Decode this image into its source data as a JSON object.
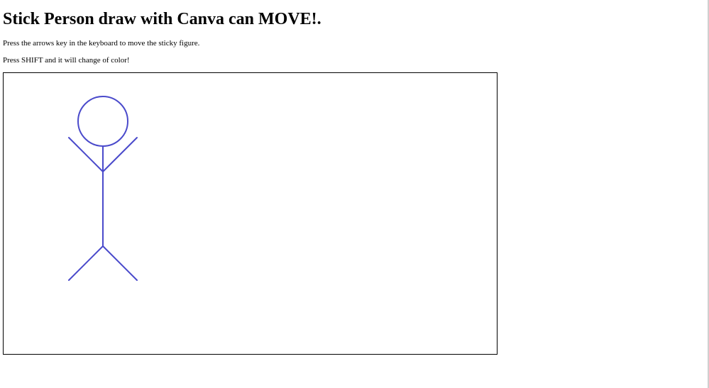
{
  "page": {
    "title": "Stick Person draw with Canva can MOVE!.",
    "instructions": [
      "Press the arrows key in the keyboard to move the sticky figure.",
      "Press SHIFT and it will change of color!"
    ]
  },
  "canvas": {
    "background": "#ffffff",
    "border_color": "#000000"
  },
  "stick_figure": {
    "color": "#4a4acb"
  }
}
